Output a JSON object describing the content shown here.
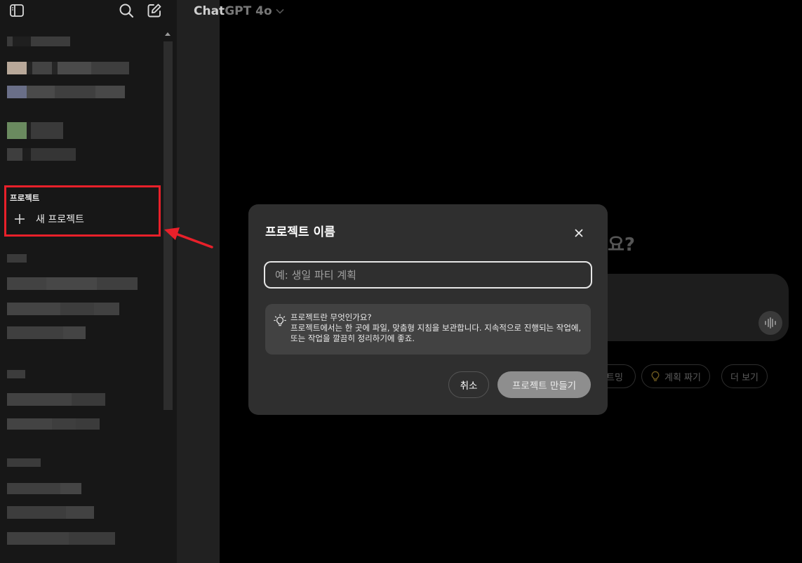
{
  "header": {
    "model_title_hidden": "Chat",
    "model_title_visible": "GPT 4o"
  },
  "sidebar": {
    "icons": [
      "sidebar-toggle-icon",
      "search-icon",
      "new-chat-icon"
    ],
    "projects": {
      "header": "프로젝트",
      "new_project_label": "새 프로젝트"
    }
  },
  "background": {
    "heading_tail": "요?",
    "chips": [
      {
        "label": "트밍"
      },
      {
        "label": "계획 짜기",
        "icon": "lightbulb-icon"
      },
      {
        "label": "더 보기"
      }
    ]
  },
  "modal": {
    "title": "프로젝트 이름",
    "input_placeholder": "예: 생일 파티 계획",
    "info_title": "프로젝트란 무엇인가요?",
    "info_body": "프로젝트에서는 한 곳에 파일, 맞춤형 지침을 보관합니다. 지속적으로 진행되는 작업에, 또는 작업을 깔끔히 정리하기에 좋죠.",
    "cancel_label": "취소",
    "create_label": "프로젝트 만들기"
  },
  "colors": {
    "annotation": "#e8202a",
    "modal_bg": "#2f2f2f",
    "sidebar_bg": "#171717"
  }
}
